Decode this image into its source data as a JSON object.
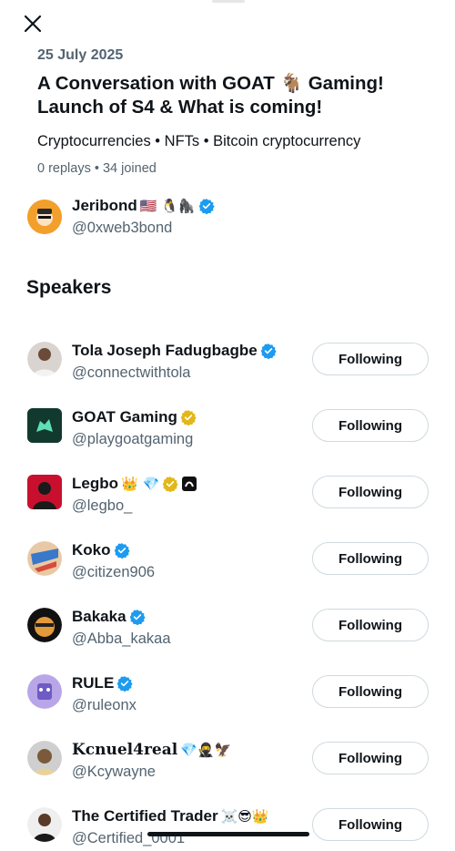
{
  "space": {
    "date": "25 July 2025",
    "title_line1": "A Conversation with GOAT 🐐 Gaming!",
    "title_line2": "Launch of S4 & What is coming!",
    "topics": "Cryptocurrencies • NFTs • Bitcoin cryptocurrency",
    "stats": "0 replays • 34 joined"
  },
  "host": {
    "name": "Jeribond",
    "emojis": "🇺🇸 🐧🦍",
    "handle": "@0xweb3bond",
    "verified": "blue"
  },
  "speakers_title": "Speakers",
  "speakers": [
    {
      "name": "Tola Joseph Fadugbagbe",
      "emojis": "",
      "handle": "@connectwithtola",
      "verified": "blue",
      "button": "Following"
    },
    {
      "name": "GOAT Gaming",
      "emojis": "",
      "handle": "@playgoatgaming",
      "verified": "gold",
      "button": "Following"
    },
    {
      "name": "Legbo",
      "emojis": "👑 💎",
      "handle": "@legbo_",
      "verified": "gold",
      "button": "Following"
    },
    {
      "name": "Koko",
      "emojis": "",
      "handle": "@citizen906",
      "verified": "blue",
      "button": "Following"
    },
    {
      "name": "Bakaka",
      "emojis": "",
      "handle": "@Abba_kakaa",
      "verified": "blue",
      "button": "Following"
    },
    {
      "name": "RULE",
      "emojis": "",
      "handle": "@ruleonx",
      "verified": "blue",
      "button": "Following"
    },
    {
      "name": "Kcnuel4real",
      "emojis": "💎🥷🦅",
      "handle": "@Kcywayne",
      "verified": "",
      "button": "Following"
    },
    {
      "name": "The Certified Trader",
      "emojis": "☠️😎👑",
      "handle": "@Certified_0001",
      "verified": "",
      "button": "Following"
    }
  ],
  "colors": {
    "verified_blue": "#1d9bf0",
    "verified_gold": "#e2b719",
    "secondary_text": "#536471"
  }
}
